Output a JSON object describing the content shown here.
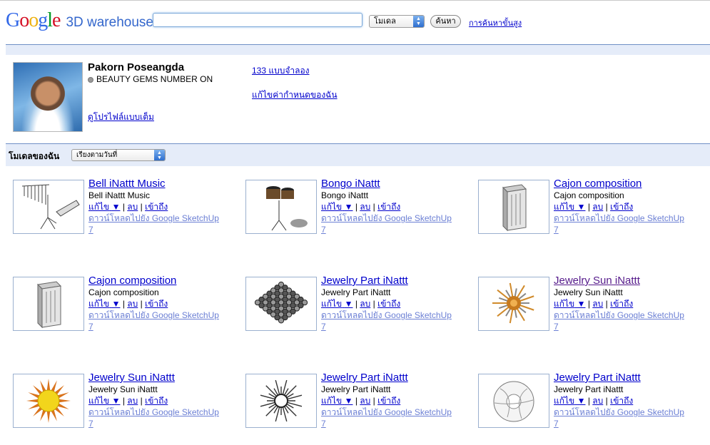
{
  "header": {
    "logo_google": "Google",
    "logo_product": "3D warehouse",
    "search_value": "",
    "search_scope": "โมเดล",
    "search_button": "ค้นหา",
    "advanced_search": "การค้นหาขั้นสูง"
  },
  "profile": {
    "name": "Pakorn Poseangda",
    "status": "BEAUTY GEMS NUMBER ON",
    "full_profile": "ดูโปรไฟล์แบบเต็ม",
    "model_count": "133 แบบจำลอง",
    "edit_settings": "แก้ไขค่ากำหนดของฉัน"
  },
  "models_bar": {
    "label": "โมเดลของฉัน",
    "sort": "เรียงตามวันที่"
  },
  "actions": {
    "edit": "แก้ไข",
    "edit_arrow": "▼",
    "sep": "|",
    "delete": "ลบ",
    "access": "เข้าถึง",
    "download": "ดาวน์โหลดไปยัง Google SketchUp",
    "version": "7"
  },
  "models": [
    {
      "title": "Bell iNattt Music",
      "subtitle": "Bell iNattt Music",
      "thumb": "chimes-stand-icon"
    },
    {
      "title": "Bongo iNattt",
      "subtitle": "Bongo iNattt",
      "thumb": "bongo-drum-icon"
    },
    {
      "title": "Cajon composition",
      "subtitle": "Cajon composition",
      "thumb": "cajon-box-icon"
    },
    {
      "title": "Cajon composition",
      "subtitle": "Cajon composition",
      "thumb": "cajon-box-icon"
    },
    {
      "title": "Jewelry Part iNattt",
      "subtitle": "Jewelry Part iNattt",
      "thumb": "gem-grid-icon"
    },
    {
      "title": "Jewelry Sun iNattt",
      "subtitle": "Jewelry Sun iNattt",
      "thumb": "spiky-sun-icon",
      "visited": true
    },
    {
      "title": "Jewelry Sun iNattt",
      "subtitle": "Jewelry Sun iNattt",
      "thumb": "golden-sun-icon"
    },
    {
      "title": "Jewelry Part iNattt",
      "subtitle": "Jewelry Part iNattt",
      "thumb": "star-flower-icon"
    },
    {
      "title": "Jewelry Part iNattt",
      "subtitle": "Jewelry Part iNattt",
      "thumb": "swirl-ring-icon"
    }
  ]
}
